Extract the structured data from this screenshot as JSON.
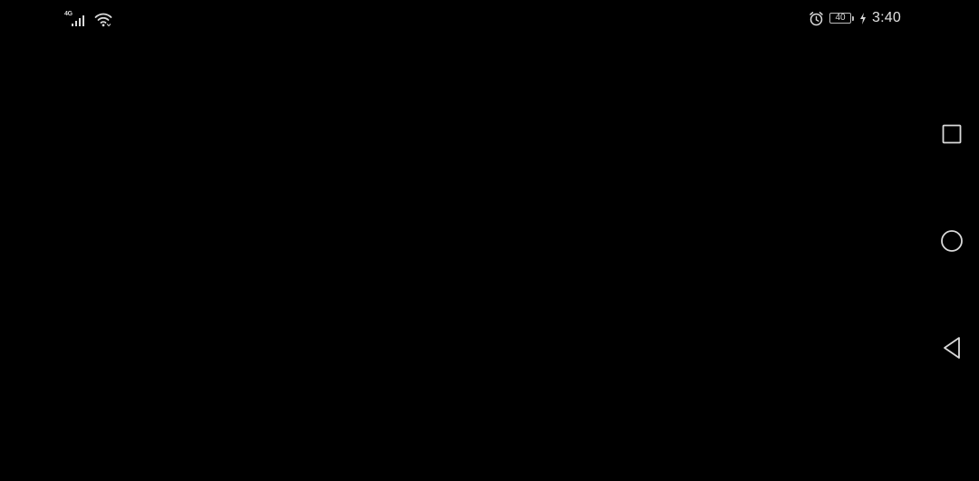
{
  "status_bar": {
    "network_type": "4G",
    "signal_icon": "signal-bars-icon",
    "wifi_icon": "wifi-icon",
    "alarm_icon": "alarm-clock-icon",
    "battery_level": "40",
    "charging_icon": "charging-bolt-icon",
    "time": "3:40"
  },
  "nav_bar": {
    "recents_icon": "square-recents-icon",
    "home_icon": "circle-home-icon",
    "back_icon": "triangle-back-icon"
  },
  "colors": {
    "background": "#000000",
    "foreground": "#d9d9d9"
  }
}
